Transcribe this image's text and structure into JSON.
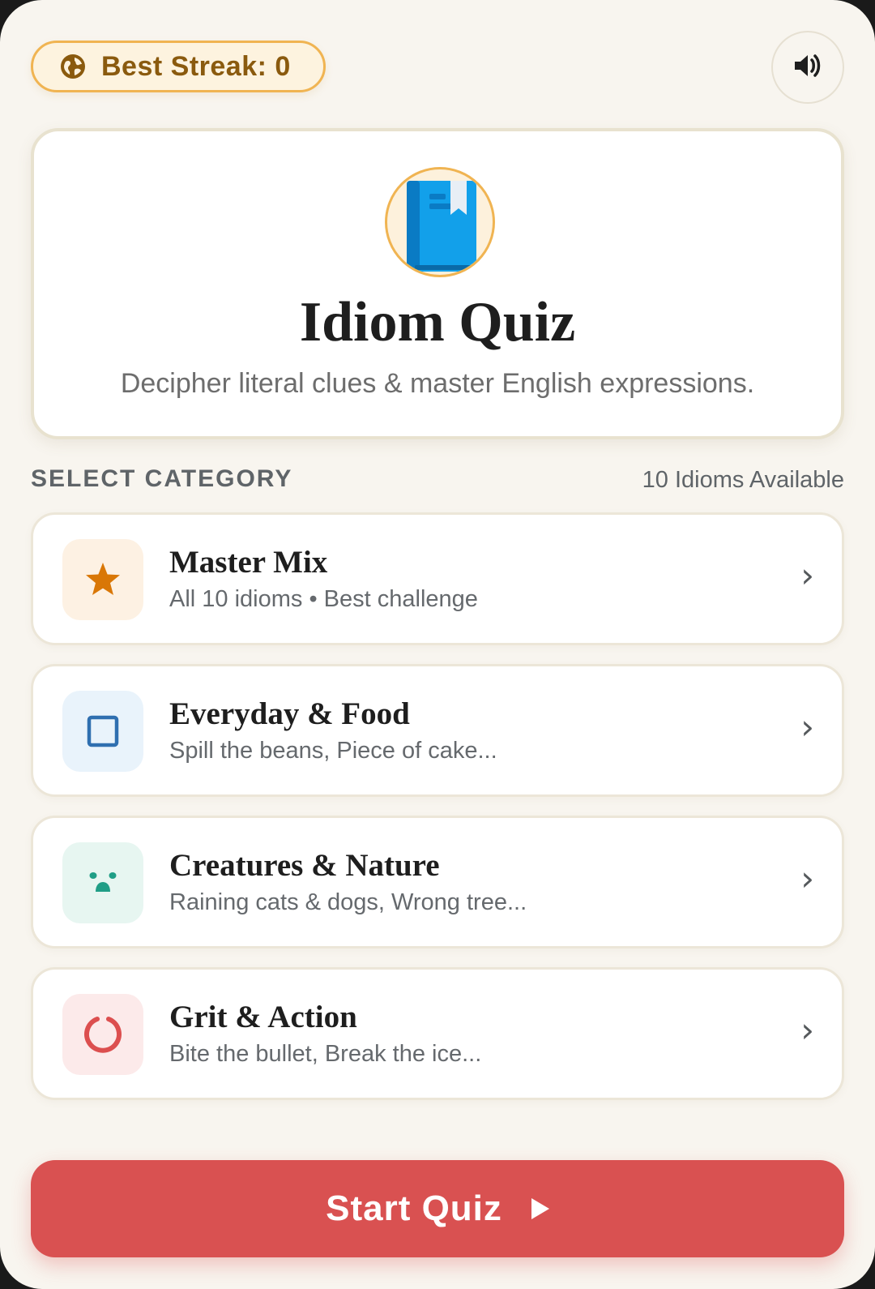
{
  "header": {
    "streak_label": "Best Streak: 0",
    "streak_icon": "globe-icon",
    "sound_icon": "speaker-icon"
  },
  "hero": {
    "logo_icon": "book-icon",
    "title": "Idiom Quiz",
    "subtitle": "Decipher literal clues & master English expressions."
  },
  "section": {
    "title": "SELECT CATEGORY",
    "count": "10 Idioms Available"
  },
  "categories": [
    {
      "title": "Master Mix",
      "subtitle": "All 10 idioms • Best challenge",
      "icon": "star-icon",
      "color": "#d97706",
      "bg": "#fdf1e3",
      "chevron": "›"
    },
    {
      "title": "Everyday & Food",
      "subtitle": "Spill the beans, Piece of cake...",
      "icon": "square-icon",
      "color": "#2f6fb0",
      "bg": "#e9f3fb",
      "chevron": "›"
    },
    {
      "title": "Creatures & Nature",
      "subtitle": "Raining cats & dogs, Wrong tree...",
      "icon": "paw-icon",
      "color": "#1f9e86",
      "bg": "#e7f6f1",
      "chevron": "›"
    },
    {
      "title": "Grit & Action",
      "subtitle": "Bite the bullet, Break the ice...",
      "icon": "ring-icon",
      "color": "#dc4f4f",
      "bg": "#fceaea",
      "chevron": "›"
    }
  ],
  "start_button": {
    "label": "Start Quiz",
    "icon": "play-icon",
    "color": "#d95151"
  }
}
